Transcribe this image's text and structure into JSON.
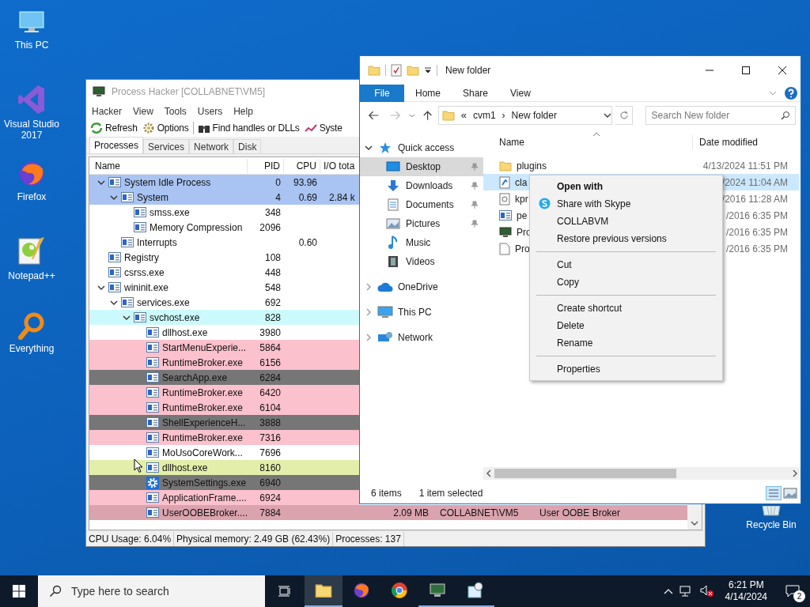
{
  "desktop_icons": [
    {
      "label": "This PC"
    },
    {
      "label": "Visual Studio 2017"
    },
    {
      "label": "Firefox"
    },
    {
      "label": "Notepad++"
    },
    {
      "label": "Everything"
    }
  ],
  "recycle_bin": {
    "label": "Recycle Bin"
  },
  "process_hacker": {
    "title": "Process Hacker [COLLABNET\\VM5]",
    "menu": [
      "Hacker",
      "View",
      "Tools",
      "Users",
      "Help"
    ],
    "toolbar": [
      "Refresh",
      "Options",
      "Find handles or DLLs",
      "Syste"
    ],
    "tabs": [
      {
        "label": "Processes",
        "selected": true
      },
      {
        "label": "Services",
        "selected": false
      },
      {
        "label": "Network",
        "selected": false
      },
      {
        "label": "Disk",
        "selected": false
      }
    ],
    "columns": [
      "Name",
      "PID",
      "CPU",
      "I/O tota"
    ],
    "rows": [
      {
        "name": "System Idle Process",
        "pid": "0",
        "cpu": "93.96",
        "color": "#a9c4f2",
        "expanded": true,
        "children": [
          {
            "name": "System",
            "pid": "4",
            "cpu": "0.69",
            "io": "2.84 k",
            "color": "#a9c4f2",
            "expanded": true,
            "children": [
              {
                "name": "smss.exe",
                "pid": "348",
                "color": "#ffffff"
              },
              {
                "name": "Memory Compression",
                "pid": "2096",
                "color": "#ffffff"
              }
            ]
          },
          {
            "name": "Interrupts",
            "cpu": "0.60",
            "color": "#ffffff"
          }
        ]
      },
      {
        "name": "Registry",
        "pid": "108",
        "color": "#ffffff"
      },
      {
        "name": "csrss.exe",
        "pid": "448",
        "color": "#ffffff"
      },
      {
        "name": "wininit.exe",
        "pid": "548",
        "color": "#ffffff",
        "expanded": true,
        "children": [
          {
            "name": "services.exe",
            "pid": "692",
            "color": "#ffffff",
            "expanded": true,
            "children": [
              {
                "name": "svchost.exe",
                "pid": "828",
                "color": "#ccfafc",
                "expanded": true,
                "children": [
                  {
                    "name": "dllhost.exe",
                    "pid": "3980",
                    "color": "#ffffff"
                  },
                  {
                    "name": "StartMenuExperie...",
                    "pid": "5864",
                    "color": "#fbc1cc"
                  },
                  {
                    "name": "RuntimeBroker.exe",
                    "pid": "6156",
                    "color": "#fbc1cc"
                  },
                  {
                    "name": "SearchApp.exe",
                    "pid": "6284",
                    "color": "#767676"
                  },
                  {
                    "name": "RuntimeBroker.exe",
                    "pid": "6420",
                    "color": "#fbc1cc"
                  },
                  {
                    "name": "RuntimeBroker.exe",
                    "pid": "6104",
                    "color": "#fbc1cc"
                  },
                  {
                    "name": "ShellExperienceH...",
                    "pid": "3888",
                    "color": "#767676"
                  },
                  {
                    "name": "RuntimeBroker.exe",
                    "pid": "7316",
                    "color": "#fbc1cc"
                  },
                  {
                    "name": "MoUsoCoreWork...",
                    "pid": "7696",
                    "color": "#ffffff"
                  },
                  {
                    "name": "dllhost.exe",
                    "pid": "8160",
                    "color": "#e3eeaa"
                  },
                  {
                    "name": "SystemSettings.exe",
                    "pid": "6940",
                    "color": "#767676",
                    "kind": "settings"
                  },
                  {
                    "name": "ApplicationFrame....",
                    "pid": "6924",
                    "color": "#fbc1cc"
                  },
                  {
                    "name": "UserOOBEBroker....",
                    "pid": "7884",
                    "color": "#dba3ae",
                    "memory": "2.09 MB",
                    "user": "COLLABNET\\VM5",
                    "description": "User OOBE Broker"
                  }
                ]
              }
            ]
          }
        ]
      }
    ],
    "status": [
      "CPU Usage: 6.04%",
      "Physical memory: 2.49 GB (62.43%)",
      "Processes: 137"
    ]
  },
  "explorer": {
    "title": "New folder",
    "ribbon_tabs": [
      {
        "label": "File",
        "selected": true
      },
      {
        "label": "Home",
        "selected": false
      },
      {
        "label": "Share",
        "selected": false
      },
      {
        "label": "View",
        "selected": false
      }
    ],
    "address": {
      "overflow": "«",
      "crumbs": [
        "cvm1",
        "New folder"
      ],
      "separator": "›"
    },
    "search": {
      "placeholder": "Search New folder"
    },
    "nav": [
      {
        "label": "Quick access",
        "expanded": true,
        "children": [
          {
            "label": "Desktop",
            "selected": true,
            "pinned": true
          },
          {
            "label": "Downloads",
            "selected": false,
            "pinned": true
          },
          {
            "label": "Documents",
            "selected": false,
            "pinned": true
          },
          {
            "label": "Pictures",
            "selected": false,
            "pinned": true
          },
          {
            "label": "Music",
            "selected": false,
            "pinned": false
          },
          {
            "label": "Videos",
            "selected": false,
            "pinned": false
          }
        ]
      },
      {
        "label": "OneDrive",
        "expanded": false
      },
      {
        "label": "This PC",
        "expanded": false
      },
      {
        "label": "Network",
        "expanded": false
      }
    ],
    "columns": [
      "Name",
      "Date modified"
    ],
    "files": [
      {
        "name": "plugins",
        "date": "4/13/2024 11:51 PM",
        "selected": false
      },
      {
        "name": "cla",
        "date": "/2024 11:04 AM",
        "selected": true
      },
      {
        "name": "kpr",
        "date": "/2016 11:28 AM",
        "selected": false
      },
      {
        "name": "pe",
        "date": "/2016 6:35 PM",
        "selected": false
      },
      {
        "name": "Pro",
        "date": "/2016 6:35 PM",
        "selected": false
      },
      {
        "name": "Pro",
        "date": "/2016 6:35 PM",
        "selected": false
      }
    ],
    "status": [
      "6 items",
      "1 item selected"
    ]
  },
  "context_menu": {
    "groups": [
      [
        {
          "label": "Open with",
          "default": true
        },
        {
          "label": "Share with Skype",
          "default": false
        },
        {
          "label": "COLLABVM",
          "default": false
        },
        {
          "label": "Restore previous versions",
          "default": false
        }
      ],
      [
        {
          "label": "Cut",
          "default": false
        },
        {
          "label": "Copy",
          "default": false
        }
      ],
      [
        {
          "label": "Create shortcut",
          "default": false
        },
        {
          "label": "Delete",
          "default": false
        },
        {
          "label": "Rename",
          "default": false
        }
      ],
      [
        {
          "label": "Properties",
          "default": false
        }
      ]
    ]
  },
  "taskbar": {
    "search": {
      "placeholder": "Type here to search"
    },
    "apps": [
      {
        "active": true,
        "running": true
      },
      {
        "active": false,
        "running": false
      },
      {
        "active": false,
        "running": false
      },
      {
        "active": false,
        "running": true
      },
      {
        "active": false,
        "running": true
      }
    ],
    "time": "6:21 PM",
    "date": "4/14/2024",
    "notifications": "2"
  }
}
